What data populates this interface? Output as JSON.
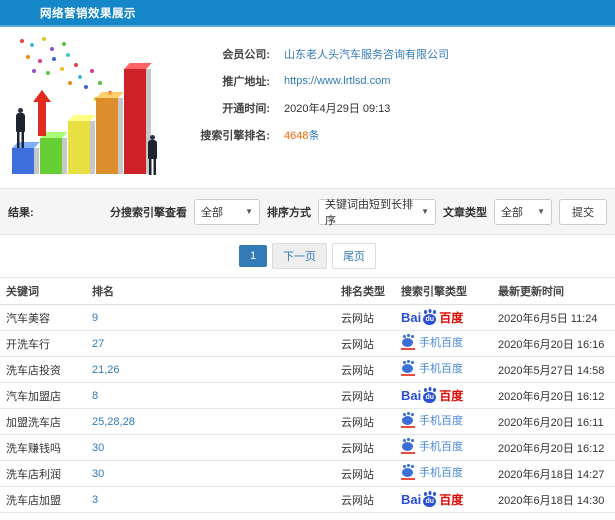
{
  "header": {
    "title": "网络营销效果展示"
  },
  "info": {
    "company_label": "会员公司:",
    "company_value": "山东老人头汽车服务咨询有限公司",
    "url_label": "推广地址:",
    "url_value": "https://www.lrtlsd.com",
    "opened_label": "开通时间:",
    "opened_value": "2020年4月29日 09:13",
    "rank_label": "搜索引擎排名:",
    "rank_count": "4648",
    "rank_unit": "条"
  },
  "filters": {
    "result_label": "结果:",
    "engine_label": "分搜索引擎查看",
    "engine_value": "全部",
    "sort_label": "排序方式",
    "sort_value": "关键词由短到长排序",
    "type_label": "文章类型",
    "type_value": "全部",
    "submit_label": "提交"
  },
  "pagination": {
    "current": "1",
    "next": "下一页",
    "last": "尾页"
  },
  "logos": {
    "baidu": {
      "prefix": "Bai",
      "paw_text": "du",
      "suffix": "百度"
    },
    "mobile": {
      "label": "手机百度"
    }
  },
  "table": {
    "headers": [
      "关键词",
      "排名",
      "排名类型",
      "搜索引擎类型",
      "最新更新时间"
    ],
    "rows": [
      {
        "keyword": "汽车美容",
        "rank": "9",
        "rank_type": "云网站",
        "engine": "baidu",
        "updated": "2020年6月5日 11:24"
      },
      {
        "keyword": "开洗车行",
        "rank": "27",
        "rank_type": "云网站",
        "engine": "mobile",
        "updated": "2020年6月20日 16:16"
      },
      {
        "keyword": "洗车店投资",
        "rank": "21,26",
        "rank_type": "云网站",
        "engine": "mobile",
        "updated": "2020年5月27日 14:58"
      },
      {
        "keyword": "汽车加盟店",
        "rank": "8",
        "rank_type": "云网站",
        "engine": "baidu",
        "updated": "2020年6月20日 16:12"
      },
      {
        "keyword": "加盟洗车店",
        "rank": "25,28,28",
        "rank_type": "云网站",
        "engine": "mobile",
        "updated": "2020年6月20日 16:11"
      },
      {
        "keyword": "洗车赚钱吗",
        "rank": "30",
        "rank_type": "云网站",
        "engine": "mobile",
        "updated": "2020年6月20日 16:12"
      },
      {
        "keyword": "洗车店利润",
        "rank": "30",
        "rank_type": "云网站",
        "engine": "mobile",
        "updated": "2020年6月18日 14:27"
      },
      {
        "keyword": "洗车店加盟",
        "rank": "3",
        "rank_type": "云网站",
        "engine": "baidu",
        "updated": "2020年6月18日 14:30"
      }
    ]
  },
  "colors": {
    "header_bg": "#1586c8",
    "accent_blue": "#337ab7",
    "count_orange": "#ff6600",
    "baidu_blue": "#2b50d8",
    "baidu_red": "#e00602"
  }
}
